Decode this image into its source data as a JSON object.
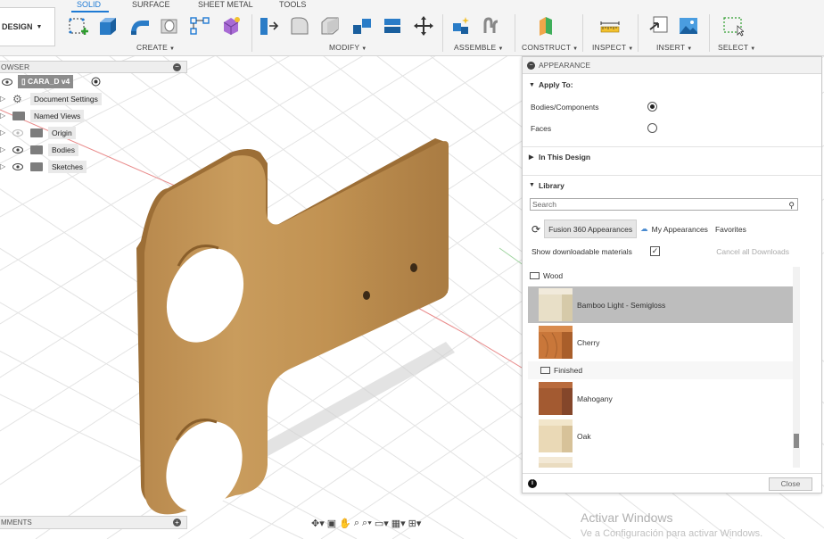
{
  "workspace": {
    "label": "DESIGN"
  },
  "tabs": [
    "SOLID",
    "SURFACE",
    "SHEET METAL",
    "TOOLS"
  ],
  "groups": {
    "create": "CREATE",
    "modify": "MODIFY",
    "assemble": "ASSEMBLE",
    "construct": "CONSTRUCT",
    "inspect": "INSPECT",
    "insert": "INSERT",
    "select": "SELECT"
  },
  "browser": {
    "title": "OWSER",
    "root": "CARA_D v4",
    "items": [
      "Document Settings",
      "Named Views",
      "Origin",
      "Bodies",
      "Sketches"
    ]
  },
  "appearance": {
    "title": "APPEARANCE",
    "apply_to": "Apply To:",
    "opt_bodies": "Bodies/Components",
    "opt_faces": "Faces",
    "in_design": "In This Design",
    "library": "Library",
    "search_placeholder": "Search",
    "tab_fusion": "Fusion 360 Appearances",
    "tab_my": "My Appearances",
    "tab_fav": "Favorites",
    "show_downloadable": "Show downloadable materials",
    "cancel_downloads": "Cancel all Downloads",
    "category_wood": "Wood",
    "category_finished": "Finished",
    "materials": [
      "Bamboo Light - Semigloss",
      "Cherry",
      "Mahogany",
      "Oak"
    ],
    "close": "Close"
  },
  "comments": {
    "title": "MMENTS"
  },
  "watermark": {
    "line1": "Activar Windows",
    "line2": "Ve a Configuración para activar Windows."
  },
  "colors": {
    "accent": "#1e7ad4",
    "wood": "#c8995a",
    "selected_row": "#bdbdbd"
  }
}
